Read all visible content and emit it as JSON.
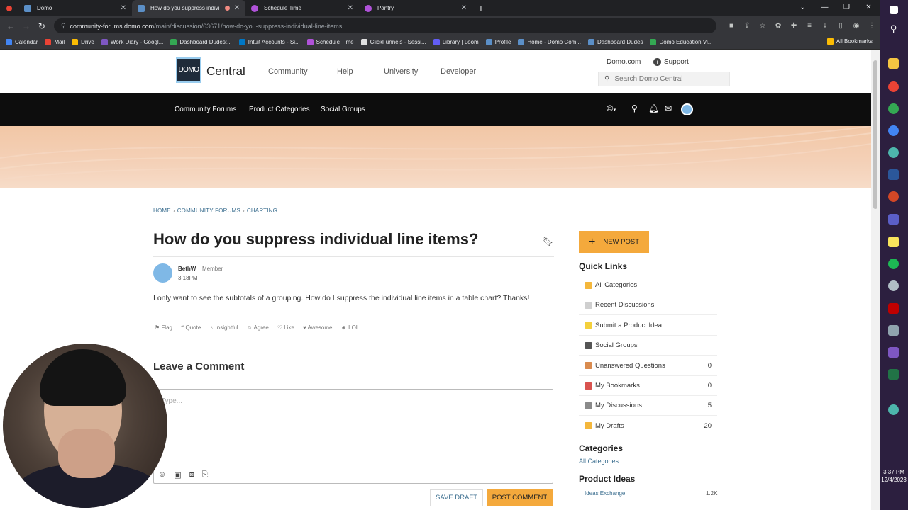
{
  "browser": {
    "tabs": [
      {
        "title": "Domo",
        "fav": "#5b8fc7",
        "active": false
      },
      {
        "title": "How do you suppress indivi",
        "fav": "#5b8fc7",
        "active": true
      },
      {
        "title": "Schedule Time",
        "fav": "#b052d9",
        "active": false
      },
      {
        "title": "Pantry",
        "fav": "#b052d9",
        "active": false
      }
    ],
    "url_host": "community-forums.domo.com",
    "url_path": "/main/discussion/63671/how-do-you-suppress-individual-line-items",
    "bookmarks": [
      {
        "label": "Calendar",
        "color": "#4285f4"
      },
      {
        "label": "Mail",
        "color": "#ea4335"
      },
      {
        "label": "Drive",
        "color": "#fbbc04"
      },
      {
        "label": "Work Diary - Googl...",
        "color": "#7e57c2"
      },
      {
        "label": "Dashboard Dudes:...",
        "color": "#34a853"
      },
      {
        "label": "Intuit Accounts - Si...",
        "color": "#0077c5"
      },
      {
        "label": "Schedule Time",
        "color": "#b052d9"
      },
      {
        "label": "ClickFunnels - Sessi...",
        "color": "#e0e0e0"
      },
      {
        "label": "Library | Loom",
        "color": "#625df5"
      },
      {
        "label": "Profile",
        "color": "#5b8fc7"
      },
      {
        "label": "Home - Domo Com...",
        "color": "#5b8fc7"
      },
      {
        "label": "Dashboard Dudes",
        "color": "#5b8fc7"
      },
      {
        "label": "Domo Education Vi...",
        "color": "#34a853"
      }
    ],
    "all_bookmarks": "All Bookmarks"
  },
  "header": {
    "logo_mark": "DOMO",
    "logo_text": "Central",
    "nav": [
      "Community",
      "Help",
      "University",
      "Developer"
    ],
    "domo_link": "Domo.com",
    "support_link": "Support",
    "search_placeholder": "Search Domo Central"
  },
  "subnav": {
    "links": [
      "Community Forums",
      "Product Categories",
      "Social Groups"
    ]
  },
  "breadcrumb": {
    "items": [
      "HOME",
      "COMMUNITY FORUMS",
      "CHARTING"
    ]
  },
  "post": {
    "title": "How do you suppress individual line items?",
    "author": "BethW",
    "role": "Member",
    "time": "3:18PM",
    "body": "I only want to see the subtotals of a grouping. How do I suppress the individual line items in a table chart? Thanks!",
    "reactions": [
      "Flag",
      "Quote",
      "Insightful",
      "Agree",
      "Like",
      "Awesome",
      "LOL"
    ]
  },
  "comment": {
    "heading": "Leave a Comment",
    "placeholder": "Type...",
    "save_draft": "SAVE DRAFT",
    "post_comment": "POST COMMENT"
  },
  "sidebar": {
    "new_post": "NEW POST",
    "quick_links_title": "Quick Links",
    "quick_links": [
      {
        "label": "All Categories",
        "count": "",
        "color": "#f4b73c"
      },
      {
        "label": "Recent Discussions",
        "count": "",
        "color": "#cfcfcf"
      },
      {
        "label": "Submit a Product Idea",
        "count": "",
        "color": "#f4d03c"
      },
      {
        "label": "Social Groups",
        "count": "",
        "color": "#555555"
      },
      {
        "label": "Unanswered Questions",
        "count": "0",
        "color": "#d98b4f"
      },
      {
        "label": "My Bookmarks",
        "count": "0",
        "color": "#d9534f"
      },
      {
        "label": "My Discussions",
        "count": "5",
        "color": "#8a8a8a"
      },
      {
        "label": "My Drafts",
        "count": "20",
        "color": "#f4b73c"
      }
    ],
    "categories_title": "Categories",
    "all_categories": "All Categories",
    "product_ideas_title": "Product Ideas",
    "ideas_exchange": "Ideas Exchange",
    "ideas_count": "1.2K"
  },
  "taskbar": {
    "time": "3:37 PM",
    "date": "12/4/2023"
  }
}
